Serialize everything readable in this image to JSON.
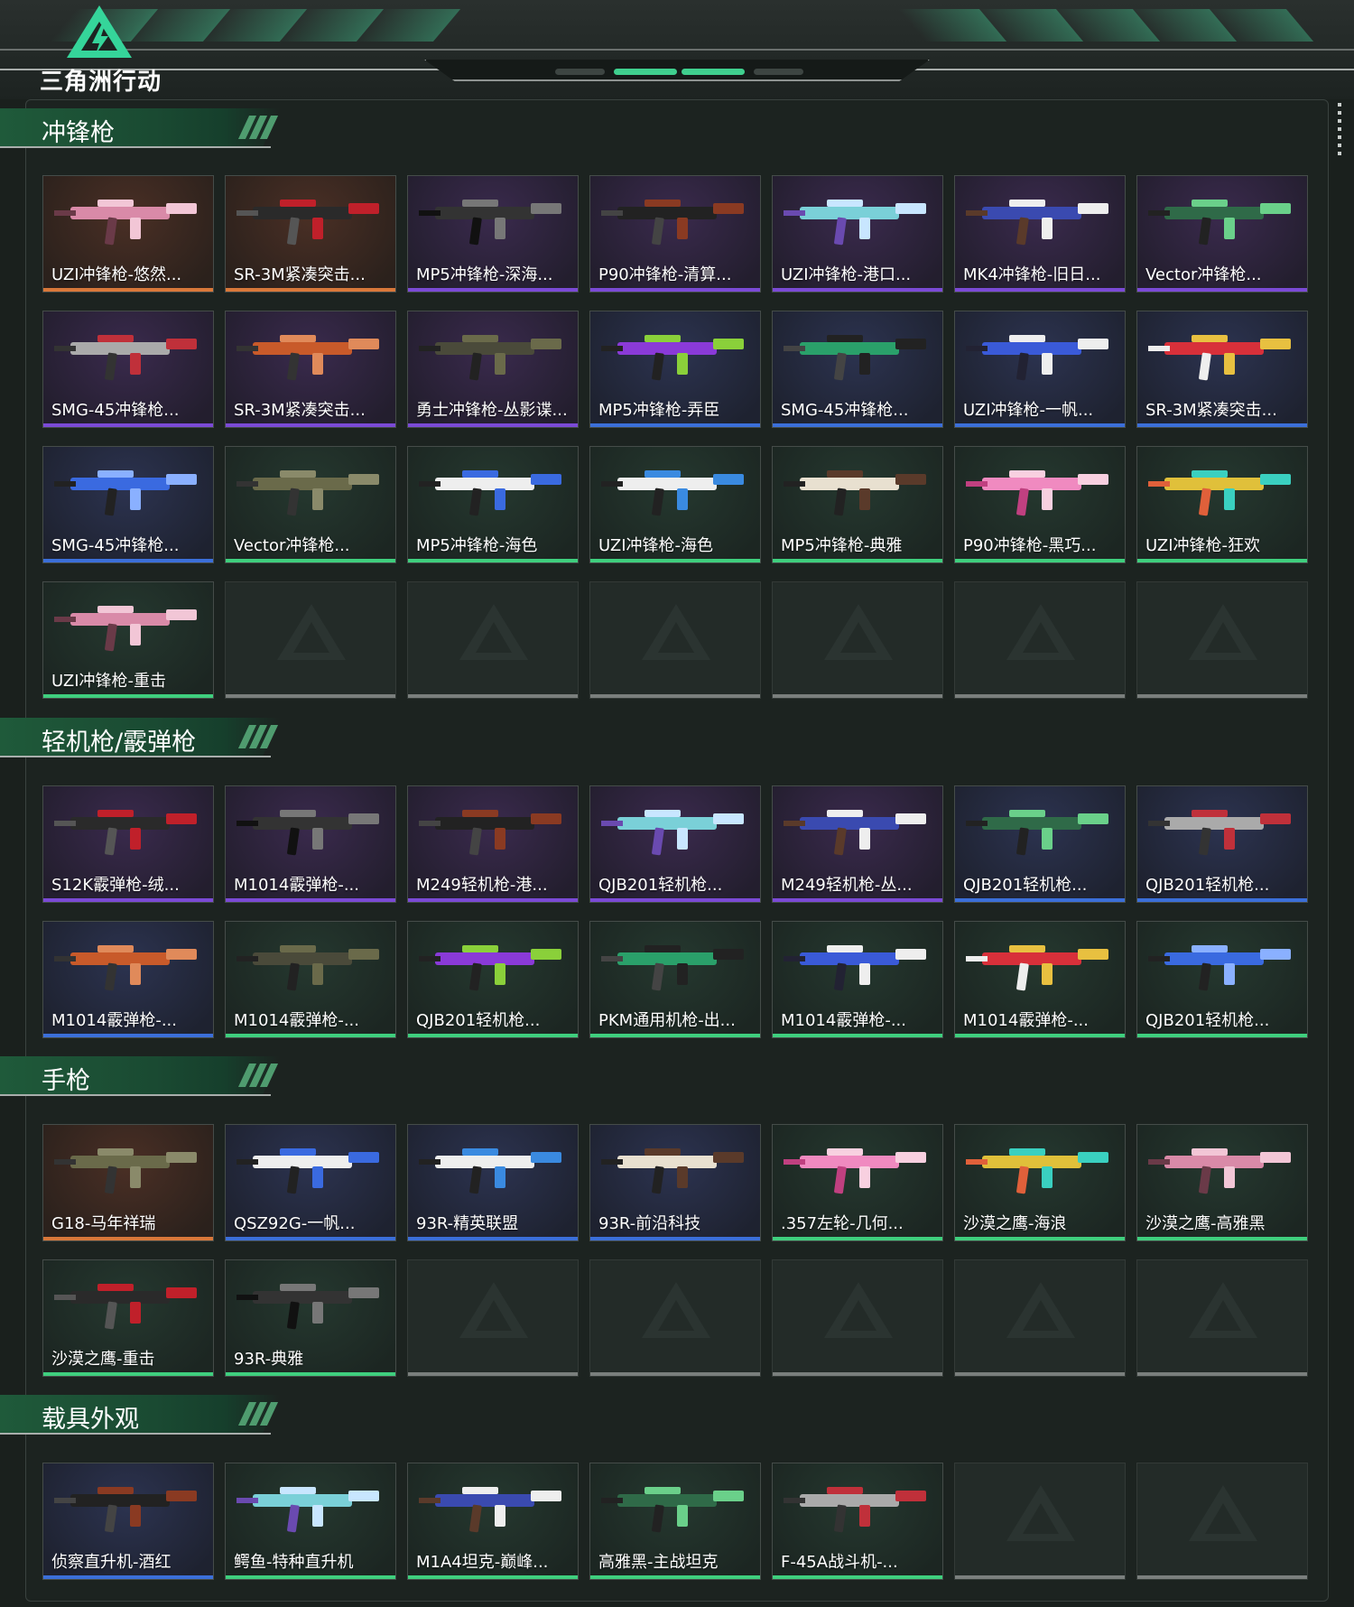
{
  "app": {
    "logo_text": "三角洲行动"
  },
  "colors": {
    "orange": "#d9783a",
    "purple": "#7b4ad6",
    "blue": "#3b6fd9",
    "green": "#3fcf7e",
    "grey": "#7a7f7d"
  },
  "sections": [
    {
      "title": "冲锋枪",
      "items": [
        {
          "name": "UZI冲锋枪-悠然...",
          "rarity": "orange"
        },
        {
          "name": "SR-3M紧凑突击...",
          "rarity": "orange"
        },
        {
          "name": "MP5冲锋枪-深海...",
          "rarity": "purple"
        },
        {
          "name": "P90冲锋枪-清算...",
          "rarity": "purple"
        },
        {
          "name": "UZI冲锋枪-港口...",
          "rarity": "purple"
        },
        {
          "name": "MK4冲锋枪-旧日...",
          "rarity": "purple"
        },
        {
          "name": "Vector冲锋枪...",
          "rarity": "purple"
        },
        {
          "name": "SMG-45冲锋枪...",
          "rarity": "purple"
        },
        {
          "name": "SR-3M紧凑突击...",
          "rarity": "purple"
        },
        {
          "name": "勇士冲锋枪-丛影谍...",
          "rarity": "purple"
        },
        {
          "name": "MP5冲锋枪-弄臣",
          "rarity": "blue"
        },
        {
          "name": "SMG-45冲锋枪...",
          "rarity": "blue"
        },
        {
          "name": "UZI冲锋枪-一帆...",
          "rarity": "blue"
        },
        {
          "name": "SR-3M紧凑突击...",
          "rarity": "blue"
        },
        {
          "name": "SMG-45冲锋枪...",
          "rarity": "blue"
        },
        {
          "name": "Vector冲锋枪...",
          "rarity": "green"
        },
        {
          "name": "MP5冲锋枪-海色",
          "rarity": "green"
        },
        {
          "name": "UZI冲锋枪-海色",
          "rarity": "green"
        },
        {
          "name": "MP5冲锋枪-典雅",
          "rarity": "green"
        },
        {
          "name": "P90冲锋枪-黑巧...",
          "rarity": "green"
        },
        {
          "name": "UZI冲锋枪-狂欢",
          "rarity": "green"
        },
        {
          "name": "UZI冲锋枪-重击",
          "rarity": "green"
        }
      ]
    },
    {
      "title": "轻机枪/霰弹枪",
      "items": [
        {
          "name": "S12K霰弹枪-绒...",
          "rarity": "purple"
        },
        {
          "name": "M1014霰弹枪-...",
          "rarity": "purple"
        },
        {
          "name": "M249轻机枪-港...",
          "rarity": "purple"
        },
        {
          "name": "QJB201轻机枪...",
          "rarity": "purple"
        },
        {
          "name": "M249轻机枪-丛...",
          "rarity": "purple"
        },
        {
          "name": "QJB201轻机枪...",
          "rarity": "blue"
        },
        {
          "name": "QJB201轻机枪...",
          "rarity": "blue"
        },
        {
          "name": "M1014霰弹枪-...",
          "rarity": "blue"
        },
        {
          "name": "M1014霰弹枪-...",
          "rarity": "green"
        },
        {
          "name": "QJB201轻机枪...",
          "rarity": "green"
        },
        {
          "name": "PKM通用机枪-出...",
          "rarity": "green"
        },
        {
          "name": "M1014霰弹枪-...",
          "rarity": "green"
        },
        {
          "name": "M1014霰弹枪-...",
          "rarity": "green"
        },
        {
          "name": "QJB201轻机枪...",
          "rarity": "green"
        }
      ]
    },
    {
      "title": "手枪",
      "items": [
        {
          "name": "G18-马年祥瑞",
          "rarity": "orange"
        },
        {
          "name": "QSZ92G-一帆...",
          "rarity": "blue"
        },
        {
          "name": "93R-精英联盟",
          "rarity": "blue"
        },
        {
          "name": "93R-前沿科技",
          "rarity": "blue"
        },
        {
          "name": ".357左轮-几何...",
          "rarity": "green"
        },
        {
          "name": "沙漠之鹰-海浪",
          "rarity": "green"
        },
        {
          "name": "沙漠之鹰-高雅黑",
          "rarity": "green"
        },
        {
          "name": "沙漠之鹰-重击",
          "rarity": "green"
        },
        {
          "name": "93R-典雅",
          "rarity": "green"
        }
      ]
    },
    {
      "title": "载具外观",
      "items": [
        {
          "name": "侦察直升机-酒红",
          "rarity": "blue"
        },
        {
          "name": "鳄鱼-特种直升机",
          "rarity": "green"
        },
        {
          "name": "M1A4坦克-巅峰...",
          "rarity": "green"
        },
        {
          "name": "高雅黑-主战坦克",
          "rarity": "green"
        },
        {
          "name": "F-45A战斗机-...",
          "rarity": "green"
        }
      ]
    }
  ]
}
